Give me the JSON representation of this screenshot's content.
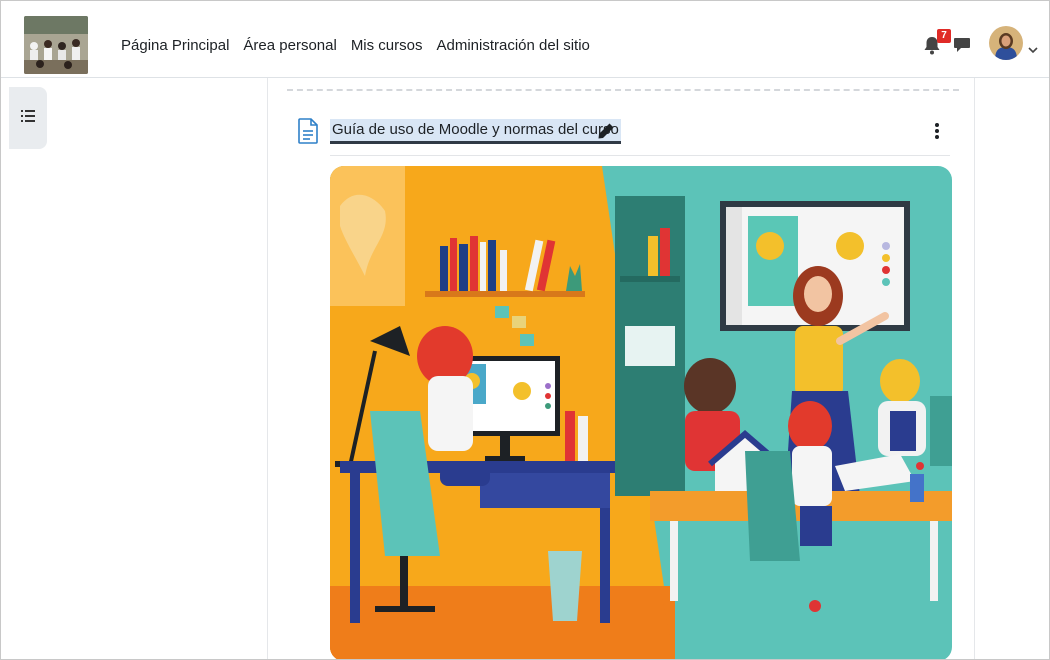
{
  "nav": {
    "items": [
      {
        "label": "Página Principal"
      },
      {
        "label": "Área personal"
      },
      {
        "label": "Mis cursos"
      },
      {
        "label": "Administración del sitio"
      }
    ],
    "notification_count": "7"
  },
  "activity": {
    "title": "Guía de uso de Moodle y normas del curso"
  },
  "icons": {
    "drawer": "list-icon",
    "notifications": "bell-icon",
    "messages": "chat-bubble-icon",
    "user_menu": "chevron-down-icon",
    "activity": "document-icon",
    "edit": "pencil-icon",
    "actions": "kebab-menu-icon"
  },
  "colors": {
    "badge": "#e02b27",
    "title_highlight": "#d9e6f5",
    "illustration_left": "#f7a81b",
    "illustration_right": "#5cc3b8"
  }
}
